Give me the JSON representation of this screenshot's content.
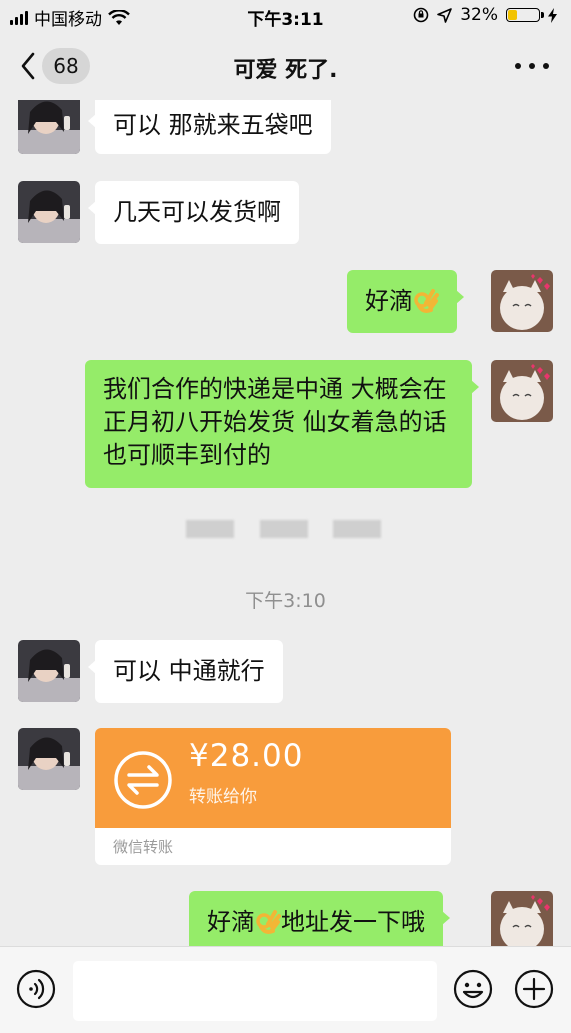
{
  "status_bar": {
    "carrier": "中国移动",
    "time": "下午3:11",
    "battery": "32%",
    "battery_level": 0.32
  },
  "nav": {
    "back_count": "68",
    "title": "可爱 死了."
  },
  "messages": [
    {
      "side": "left",
      "text": "可以 那就来五袋吧"
    },
    {
      "side": "left",
      "text": "几天可以发货啊"
    },
    {
      "side": "right",
      "text": "好滴",
      "emoji": "ok-hand-icon"
    },
    {
      "side": "right",
      "text": "我们合作的快递是中通 大概会在正月初八开始发货 仙女着急的话也可顺丰到付的"
    },
    {
      "side": "left",
      "text": "可以 中通就行"
    },
    {
      "side": "right",
      "text_before": "好滴",
      "emoji": "ok-hand-icon",
      "text_after": "地址发一下哦"
    }
  ],
  "time_divider": "下午3:10",
  "transfer": {
    "amount": "¥28.00",
    "description": "转账给你",
    "footer": "微信转账",
    "color": "#f89c3c"
  },
  "colors": {
    "background": "#ededed",
    "bubble_right": "#95ec69",
    "bubble_left": "#ffffff"
  },
  "input_bar": {
    "placeholder": ""
  }
}
